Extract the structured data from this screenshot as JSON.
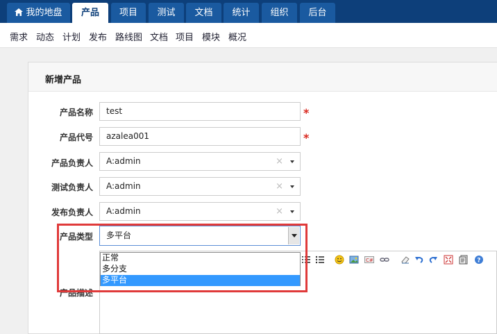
{
  "topnav": {
    "tabs": [
      {
        "label": "我的地盘",
        "active": false,
        "icon": "home-icon"
      },
      {
        "label": "产品",
        "active": true
      },
      {
        "label": "项目",
        "active": false
      },
      {
        "label": "测试",
        "active": false
      },
      {
        "label": "文档",
        "active": false
      },
      {
        "label": "统计",
        "active": false
      },
      {
        "label": "组织",
        "active": false
      },
      {
        "label": "后台",
        "active": false
      }
    ]
  },
  "subnav": {
    "items": [
      "需求",
      "动态",
      "计划",
      "发布",
      "路线图",
      "文档",
      "项目",
      "模块",
      "概况"
    ]
  },
  "form": {
    "title": "新增产品",
    "name_label": "产品名称",
    "name_value": "test",
    "code_label": "产品代号",
    "code_value": "azalea001",
    "required_mark": "*",
    "po_label": "产品负责人",
    "po_value": "A:admin",
    "qd_label": "测试负责人",
    "qd_value": "A:admin",
    "rd_label": "发布负责人",
    "rd_value": "A:admin",
    "clear_mark": "×",
    "type_label": "产品类型",
    "type_value": "多平台",
    "type_options": [
      "正常",
      "多分支",
      "多平台"
    ],
    "desc_label": "产品描述"
  },
  "colors": {
    "nav_bg": "#0d3f7a",
    "tab_bg": "#1a5aa0",
    "highlight_border": "#e03a3a",
    "selected_option": "#3399ff",
    "required": "#d9261c"
  },
  "editor_toolbar_icons": [
    "ordered-list-icon",
    "unordered-list-icon",
    "emoticon-icon",
    "image-icon",
    "code-icon",
    "link-icon",
    "eraser-icon",
    "undo-icon",
    "redo-icon",
    "fullscreen-icon",
    "source-icon",
    "help-icon"
  ]
}
